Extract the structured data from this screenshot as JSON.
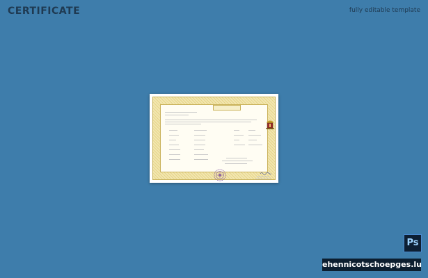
{
  "header": {
    "title": "CERTIFICATE",
    "subtitle": "fully editable template"
  },
  "badges": {
    "ps_label": "Ps",
    "watermark": "ehennicotschoepges.lu"
  },
  "colors": {
    "background": "#3e7dab",
    "border_gold": "#c9b25a",
    "paper": "#fffdf3"
  }
}
